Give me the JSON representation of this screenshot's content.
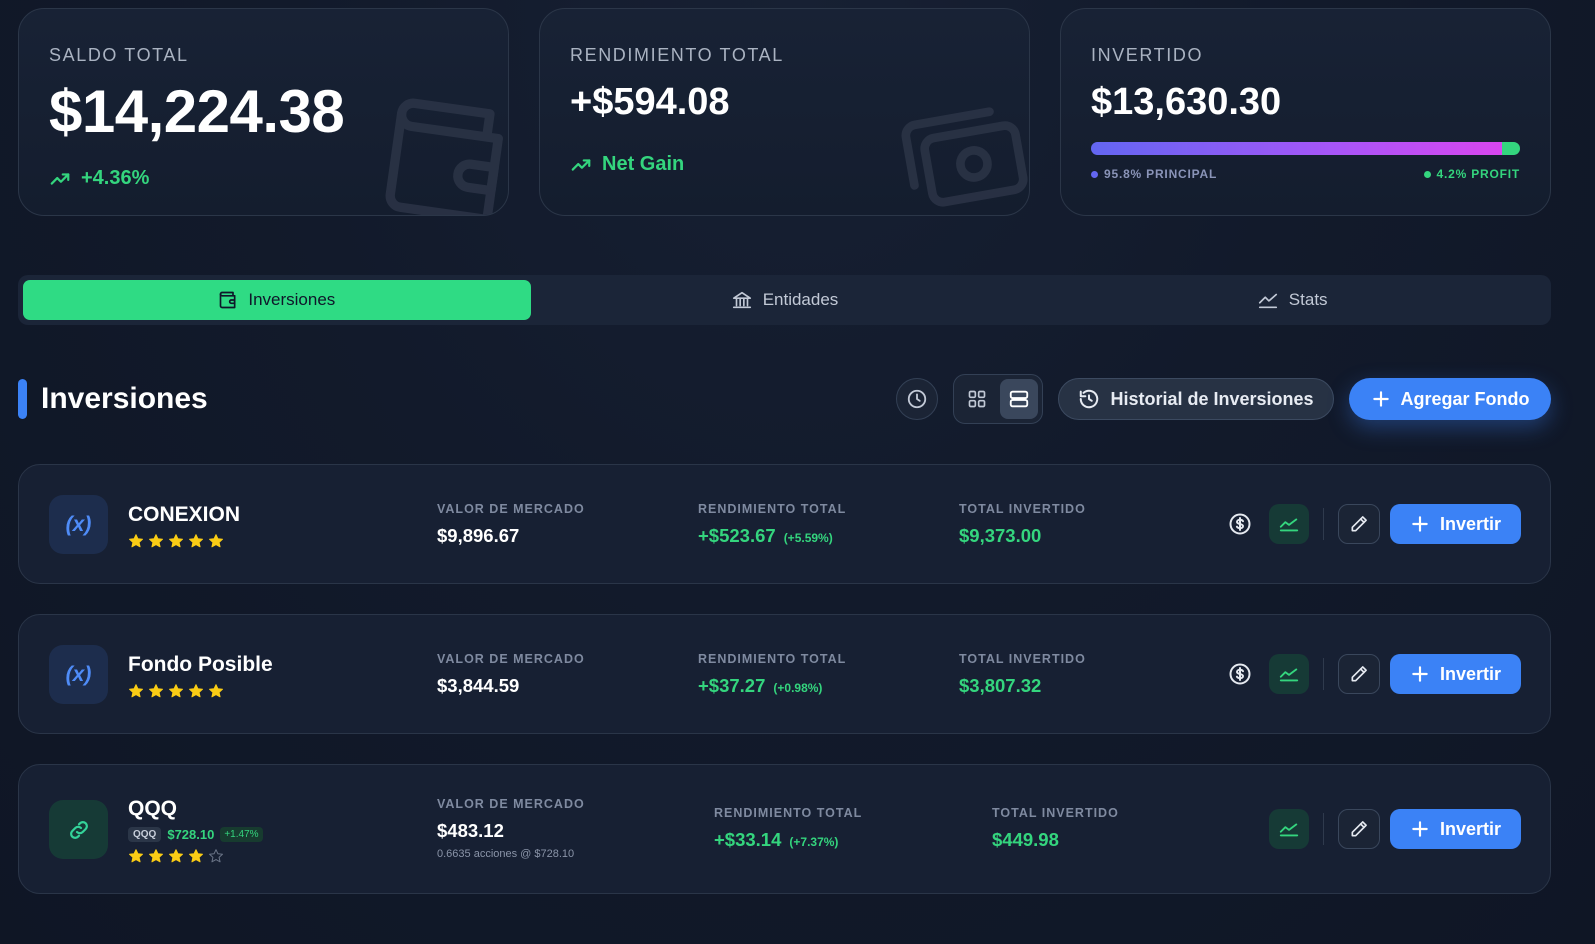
{
  "summary": {
    "saldo": {
      "label": "SALDO TOTAL",
      "value": "$14,224.38",
      "change": "+4.36%"
    },
    "rendimiento": {
      "label": "RENDIMIENTO TOTAL",
      "value": "+$594.08",
      "note": "Net Gain"
    },
    "invertido": {
      "label": "INVERTIDO",
      "value": "$13,630.30",
      "principal_label": "95.8% PRINCIPAL",
      "profit_label": "4.2% PROFIT",
      "principal_fraction": 0.958,
      "profit_fraction": 0.042
    }
  },
  "tabs": [
    {
      "label": "Inversiones",
      "icon": "wallet-icon",
      "active": true
    },
    {
      "label": "Entidades",
      "icon": "bank-icon",
      "active": false
    },
    {
      "label": "Stats",
      "icon": "chart-line-icon",
      "active": false
    }
  ],
  "section": {
    "title": "Inversiones",
    "history_button": "Historial de Inversiones",
    "add_button": "Agregar Fondo"
  },
  "funds": [
    {
      "name": "CONEXION",
      "icon": "variable-icon",
      "avatar_text": "(x)",
      "rating": 5,
      "market_label": "VALOR DE MERCADO",
      "market_value": "$9,896.67",
      "return_label": "RENDIMIENTO TOTAL",
      "return_value": "+$523.67",
      "return_pct": "(+5.59%)",
      "invested_label": "TOTAL INVERTIDO",
      "invested_value": "$9,373.00",
      "invest_button": "Invertir"
    },
    {
      "name": "Fondo Posible",
      "icon": "variable-icon",
      "avatar_text": "(x)",
      "rating": 5,
      "market_label": "VALOR DE MERCADO",
      "market_value": "$3,844.59",
      "return_label": "RENDIMIENTO TOTAL",
      "return_value": "+$37.27",
      "return_pct": "(+0.98%)",
      "invested_label": "TOTAL INVERTIDO",
      "invested_value": "$3,807.32",
      "invest_button": "Invertir"
    },
    {
      "name": "QQQ",
      "icon": "link-icon",
      "ticker": "QQQ",
      "ticker_price": "$728.10",
      "ticker_change": "+1.47%",
      "rating": 4,
      "market_label": "VALOR DE MERCADO",
      "market_value": "$483.12",
      "market_note": "0.6635 acciones @ $728.10",
      "return_label": "RENDIMIENTO TOTAL",
      "return_value": "+$33.14",
      "return_pct": "(+7.37%)",
      "invested_label": "TOTAL INVERTIDO",
      "invested_value": "$449.98",
      "invest_button": "Invertir"
    }
  ],
  "colors": {
    "accent_green": "#34d57e",
    "accent_blue": "#3b82f6",
    "star": "#facc15",
    "background": "#111827"
  }
}
